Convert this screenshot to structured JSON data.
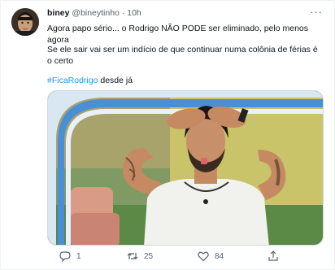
{
  "tweet": {
    "display_name": "biney",
    "handle": "@bineytinho",
    "separator": "·",
    "time": "10h",
    "more_icon": "more-horizontal-icon",
    "line1": "Agora papo sério... o Rodrigo NÃO PODE ser eliminado, pelo menos agora",
    "line2": "Se ele sair vai ser um indício de que continuar numa colônia de férias é o certo",
    "hashtag": "#FicaRodrigo",
    "hashtag_suffix": " desde já",
    "actions": {
      "reply_count": "1",
      "retweet_count": "25",
      "like_count": "84",
      "share_count": ""
    }
  },
  "colors": {
    "link": "#1d9bf0",
    "secondary_text": "#536471",
    "primary_text": "#0f1419"
  }
}
